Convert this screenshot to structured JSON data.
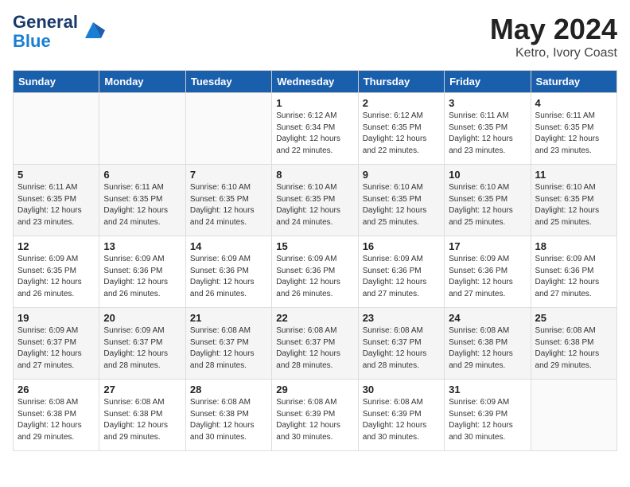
{
  "header": {
    "logo_text_general": "General",
    "logo_text_blue": "Blue",
    "month_year": "May 2024",
    "location": "Ketro, Ivory Coast"
  },
  "weekdays": [
    "Sunday",
    "Monday",
    "Tuesday",
    "Wednesday",
    "Thursday",
    "Friday",
    "Saturday"
  ],
  "weeks": [
    [
      {
        "day": "",
        "info": ""
      },
      {
        "day": "",
        "info": ""
      },
      {
        "day": "",
        "info": ""
      },
      {
        "day": "1",
        "info": "Sunrise: 6:12 AM\nSunset: 6:34 PM\nDaylight: 12 hours\nand 22 minutes."
      },
      {
        "day": "2",
        "info": "Sunrise: 6:12 AM\nSunset: 6:35 PM\nDaylight: 12 hours\nand 22 minutes."
      },
      {
        "day": "3",
        "info": "Sunrise: 6:11 AM\nSunset: 6:35 PM\nDaylight: 12 hours\nand 23 minutes."
      },
      {
        "day": "4",
        "info": "Sunrise: 6:11 AM\nSunset: 6:35 PM\nDaylight: 12 hours\nand 23 minutes."
      }
    ],
    [
      {
        "day": "5",
        "info": "Sunrise: 6:11 AM\nSunset: 6:35 PM\nDaylight: 12 hours\nand 23 minutes."
      },
      {
        "day": "6",
        "info": "Sunrise: 6:11 AM\nSunset: 6:35 PM\nDaylight: 12 hours\nand 24 minutes."
      },
      {
        "day": "7",
        "info": "Sunrise: 6:10 AM\nSunset: 6:35 PM\nDaylight: 12 hours\nand 24 minutes."
      },
      {
        "day": "8",
        "info": "Sunrise: 6:10 AM\nSunset: 6:35 PM\nDaylight: 12 hours\nand 24 minutes."
      },
      {
        "day": "9",
        "info": "Sunrise: 6:10 AM\nSunset: 6:35 PM\nDaylight: 12 hours\nand 25 minutes."
      },
      {
        "day": "10",
        "info": "Sunrise: 6:10 AM\nSunset: 6:35 PM\nDaylight: 12 hours\nand 25 minutes."
      },
      {
        "day": "11",
        "info": "Sunrise: 6:10 AM\nSunset: 6:35 PM\nDaylight: 12 hours\nand 25 minutes."
      }
    ],
    [
      {
        "day": "12",
        "info": "Sunrise: 6:09 AM\nSunset: 6:35 PM\nDaylight: 12 hours\nand 26 minutes."
      },
      {
        "day": "13",
        "info": "Sunrise: 6:09 AM\nSunset: 6:36 PM\nDaylight: 12 hours\nand 26 minutes."
      },
      {
        "day": "14",
        "info": "Sunrise: 6:09 AM\nSunset: 6:36 PM\nDaylight: 12 hours\nand 26 minutes."
      },
      {
        "day": "15",
        "info": "Sunrise: 6:09 AM\nSunset: 6:36 PM\nDaylight: 12 hours\nand 26 minutes."
      },
      {
        "day": "16",
        "info": "Sunrise: 6:09 AM\nSunset: 6:36 PM\nDaylight: 12 hours\nand 27 minutes."
      },
      {
        "day": "17",
        "info": "Sunrise: 6:09 AM\nSunset: 6:36 PM\nDaylight: 12 hours\nand 27 minutes."
      },
      {
        "day": "18",
        "info": "Sunrise: 6:09 AM\nSunset: 6:36 PM\nDaylight: 12 hours\nand 27 minutes."
      }
    ],
    [
      {
        "day": "19",
        "info": "Sunrise: 6:09 AM\nSunset: 6:37 PM\nDaylight: 12 hours\nand 27 minutes."
      },
      {
        "day": "20",
        "info": "Sunrise: 6:09 AM\nSunset: 6:37 PM\nDaylight: 12 hours\nand 28 minutes."
      },
      {
        "day": "21",
        "info": "Sunrise: 6:08 AM\nSunset: 6:37 PM\nDaylight: 12 hours\nand 28 minutes."
      },
      {
        "day": "22",
        "info": "Sunrise: 6:08 AM\nSunset: 6:37 PM\nDaylight: 12 hours\nand 28 minutes."
      },
      {
        "day": "23",
        "info": "Sunrise: 6:08 AM\nSunset: 6:37 PM\nDaylight: 12 hours\nand 28 minutes."
      },
      {
        "day": "24",
        "info": "Sunrise: 6:08 AM\nSunset: 6:38 PM\nDaylight: 12 hours\nand 29 minutes."
      },
      {
        "day": "25",
        "info": "Sunrise: 6:08 AM\nSunset: 6:38 PM\nDaylight: 12 hours\nand 29 minutes."
      }
    ],
    [
      {
        "day": "26",
        "info": "Sunrise: 6:08 AM\nSunset: 6:38 PM\nDaylight: 12 hours\nand 29 minutes."
      },
      {
        "day": "27",
        "info": "Sunrise: 6:08 AM\nSunset: 6:38 PM\nDaylight: 12 hours\nand 29 minutes."
      },
      {
        "day": "28",
        "info": "Sunrise: 6:08 AM\nSunset: 6:38 PM\nDaylight: 12 hours\nand 30 minutes."
      },
      {
        "day": "29",
        "info": "Sunrise: 6:08 AM\nSunset: 6:39 PM\nDaylight: 12 hours\nand 30 minutes."
      },
      {
        "day": "30",
        "info": "Sunrise: 6:08 AM\nSunset: 6:39 PM\nDaylight: 12 hours\nand 30 minutes."
      },
      {
        "day": "31",
        "info": "Sunrise: 6:09 AM\nSunset: 6:39 PM\nDaylight: 12 hours\nand 30 minutes."
      },
      {
        "day": "",
        "info": ""
      }
    ]
  ]
}
